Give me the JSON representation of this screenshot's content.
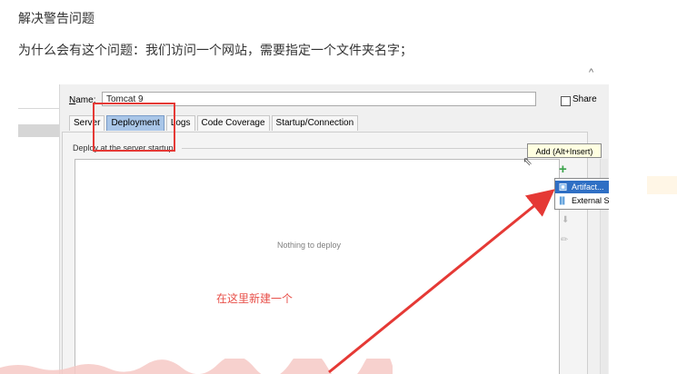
{
  "article": {
    "heading": "解决警告问题",
    "explanation": "为什么会有这个问题：我们访问一个网站，需要指定一个文件夹名字；"
  },
  "dialog": {
    "name_label_prefix": "N",
    "name_label_rest": "ame:",
    "name_value": "Tomcat 9",
    "share_label": "Share",
    "share_checked": false,
    "tabs": [
      {
        "label": "Server"
      },
      {
        "label": "Deployment"
      },
      {
        "label": "Logs"
      },
      {
        "label": "Code Coverage"
      },
      {
        "label": "Startup/Connection"
      }
    ],
    "active_tab": "Deployment",
    "deploy_section_label": "Deploy at the server startup",
    "empty_text": "Nothing to deploy",
    "tooltip": "Add (Alt+Insert)",
    "add_menu": [
      {
        "label": "Artifact...",
        "selected": true,
        "icon": "artifact-icon"
      },
      {
        "label": "External Source...",
        "selected": false,
        "icon": "external-source-icon"
      }
    ]
  },
  "annotation": {
    "text": "在这里新建一个",
    "color": "#e8504a"
  },
  "colors": {
    "highlight_box": "#e53935",
    "menu_selection": "#2f6fc4",
    "active_tab": "#a9c6e8",
    "add_icon": "#3aa34a"
  }
}
